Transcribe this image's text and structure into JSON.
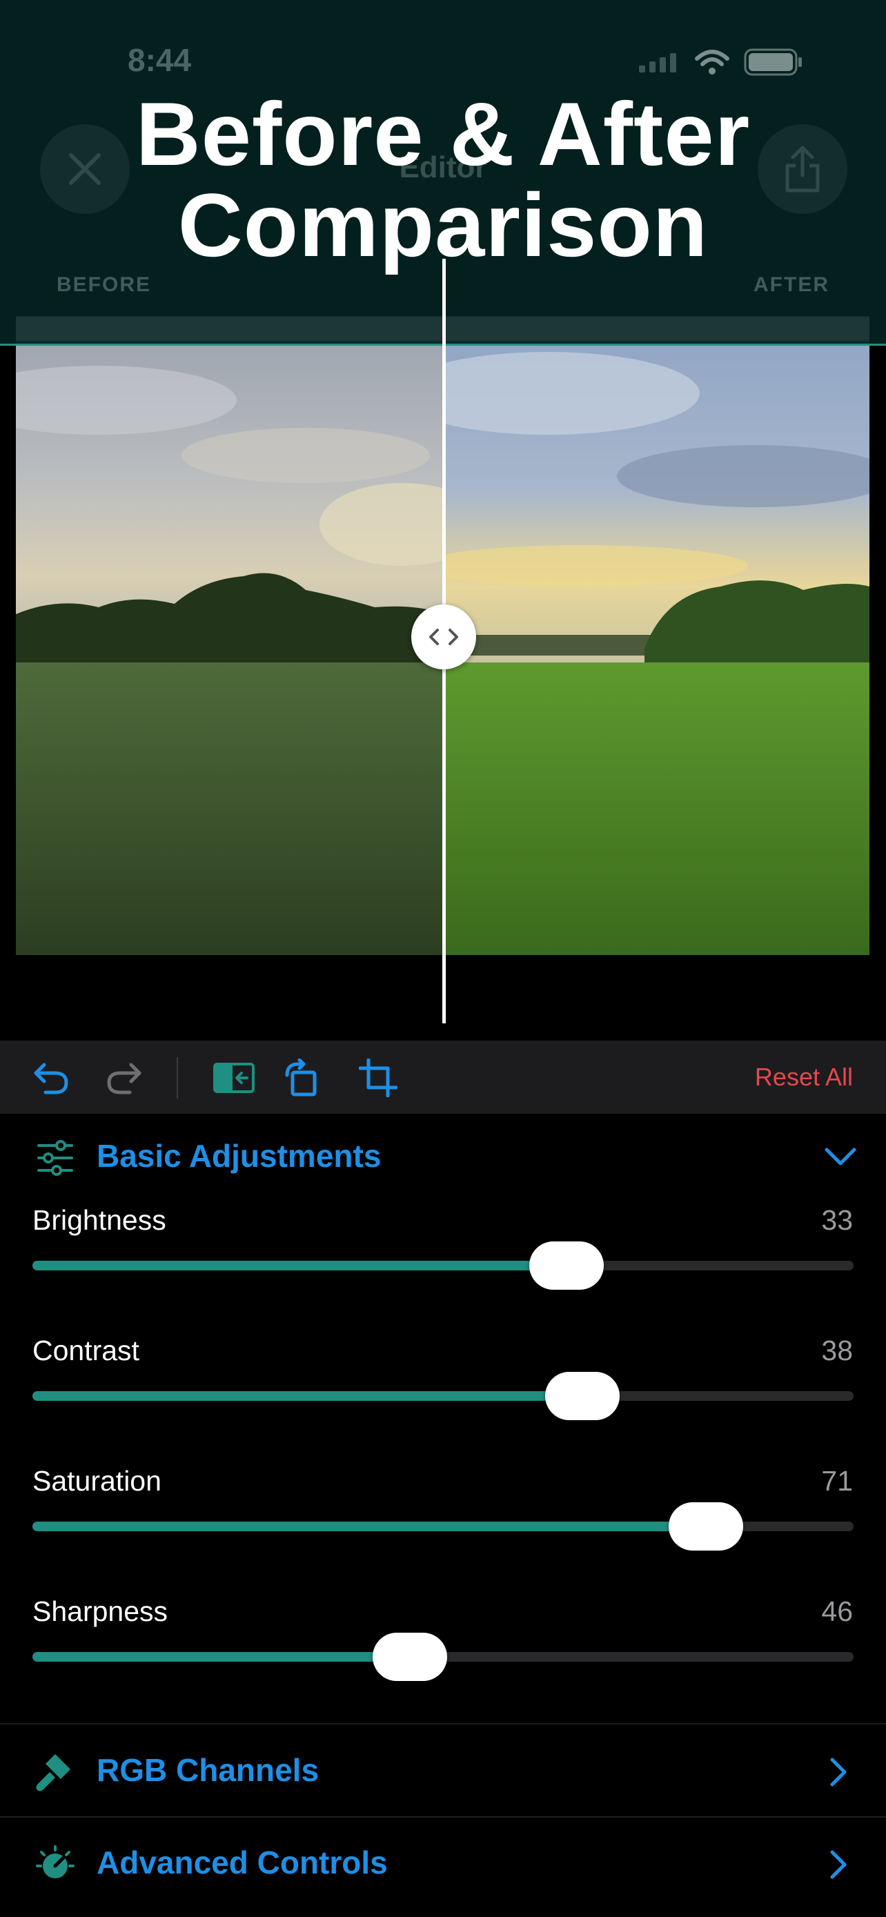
{
  "status_bar": {
    "time": "8:44"
  },
  "nav": {
    "title": "Editor"
  },
  "headline": {
    "line1": "Before & After",
    "line2": "Comparison"
  },
  "compare": {
    "before_label": "BEFORE",
    "after_label": "AFTER",
    "split_fraction": 0.5
  },
  "toolbar": {
    "reset_label": "Reset All"
  },
  "basic_adjustments": {
    "title": "Basic Adjustments",
    "sliders": [
      {
        "label": "Brightness",
        "value": "33",
        "fraction": 0.65
      },
      {
        "label": "Contrast",
        "value": "38",
        "fraction": 0.67
      },
      {
        "label": "Saturation",
        "value": "71",
        "fraction": 0.82
      },
      {
        "label": "Sharpness",
        "value": "46",
        "fraction": 0.46
      }
    ]
  },
  "sections": [
    {
      "label": "RGB Channels",
      "icon": "brush-icon"
    },
    {
      "label": "Advanced Controls",
      "icon": "dial-icon"
    }
  ],
  "colors": {
    "accent_blue": "#1e8fe6",
    "accent_teal": "#1f8f82",
    "destructive": "#e5484d"
  }
}
